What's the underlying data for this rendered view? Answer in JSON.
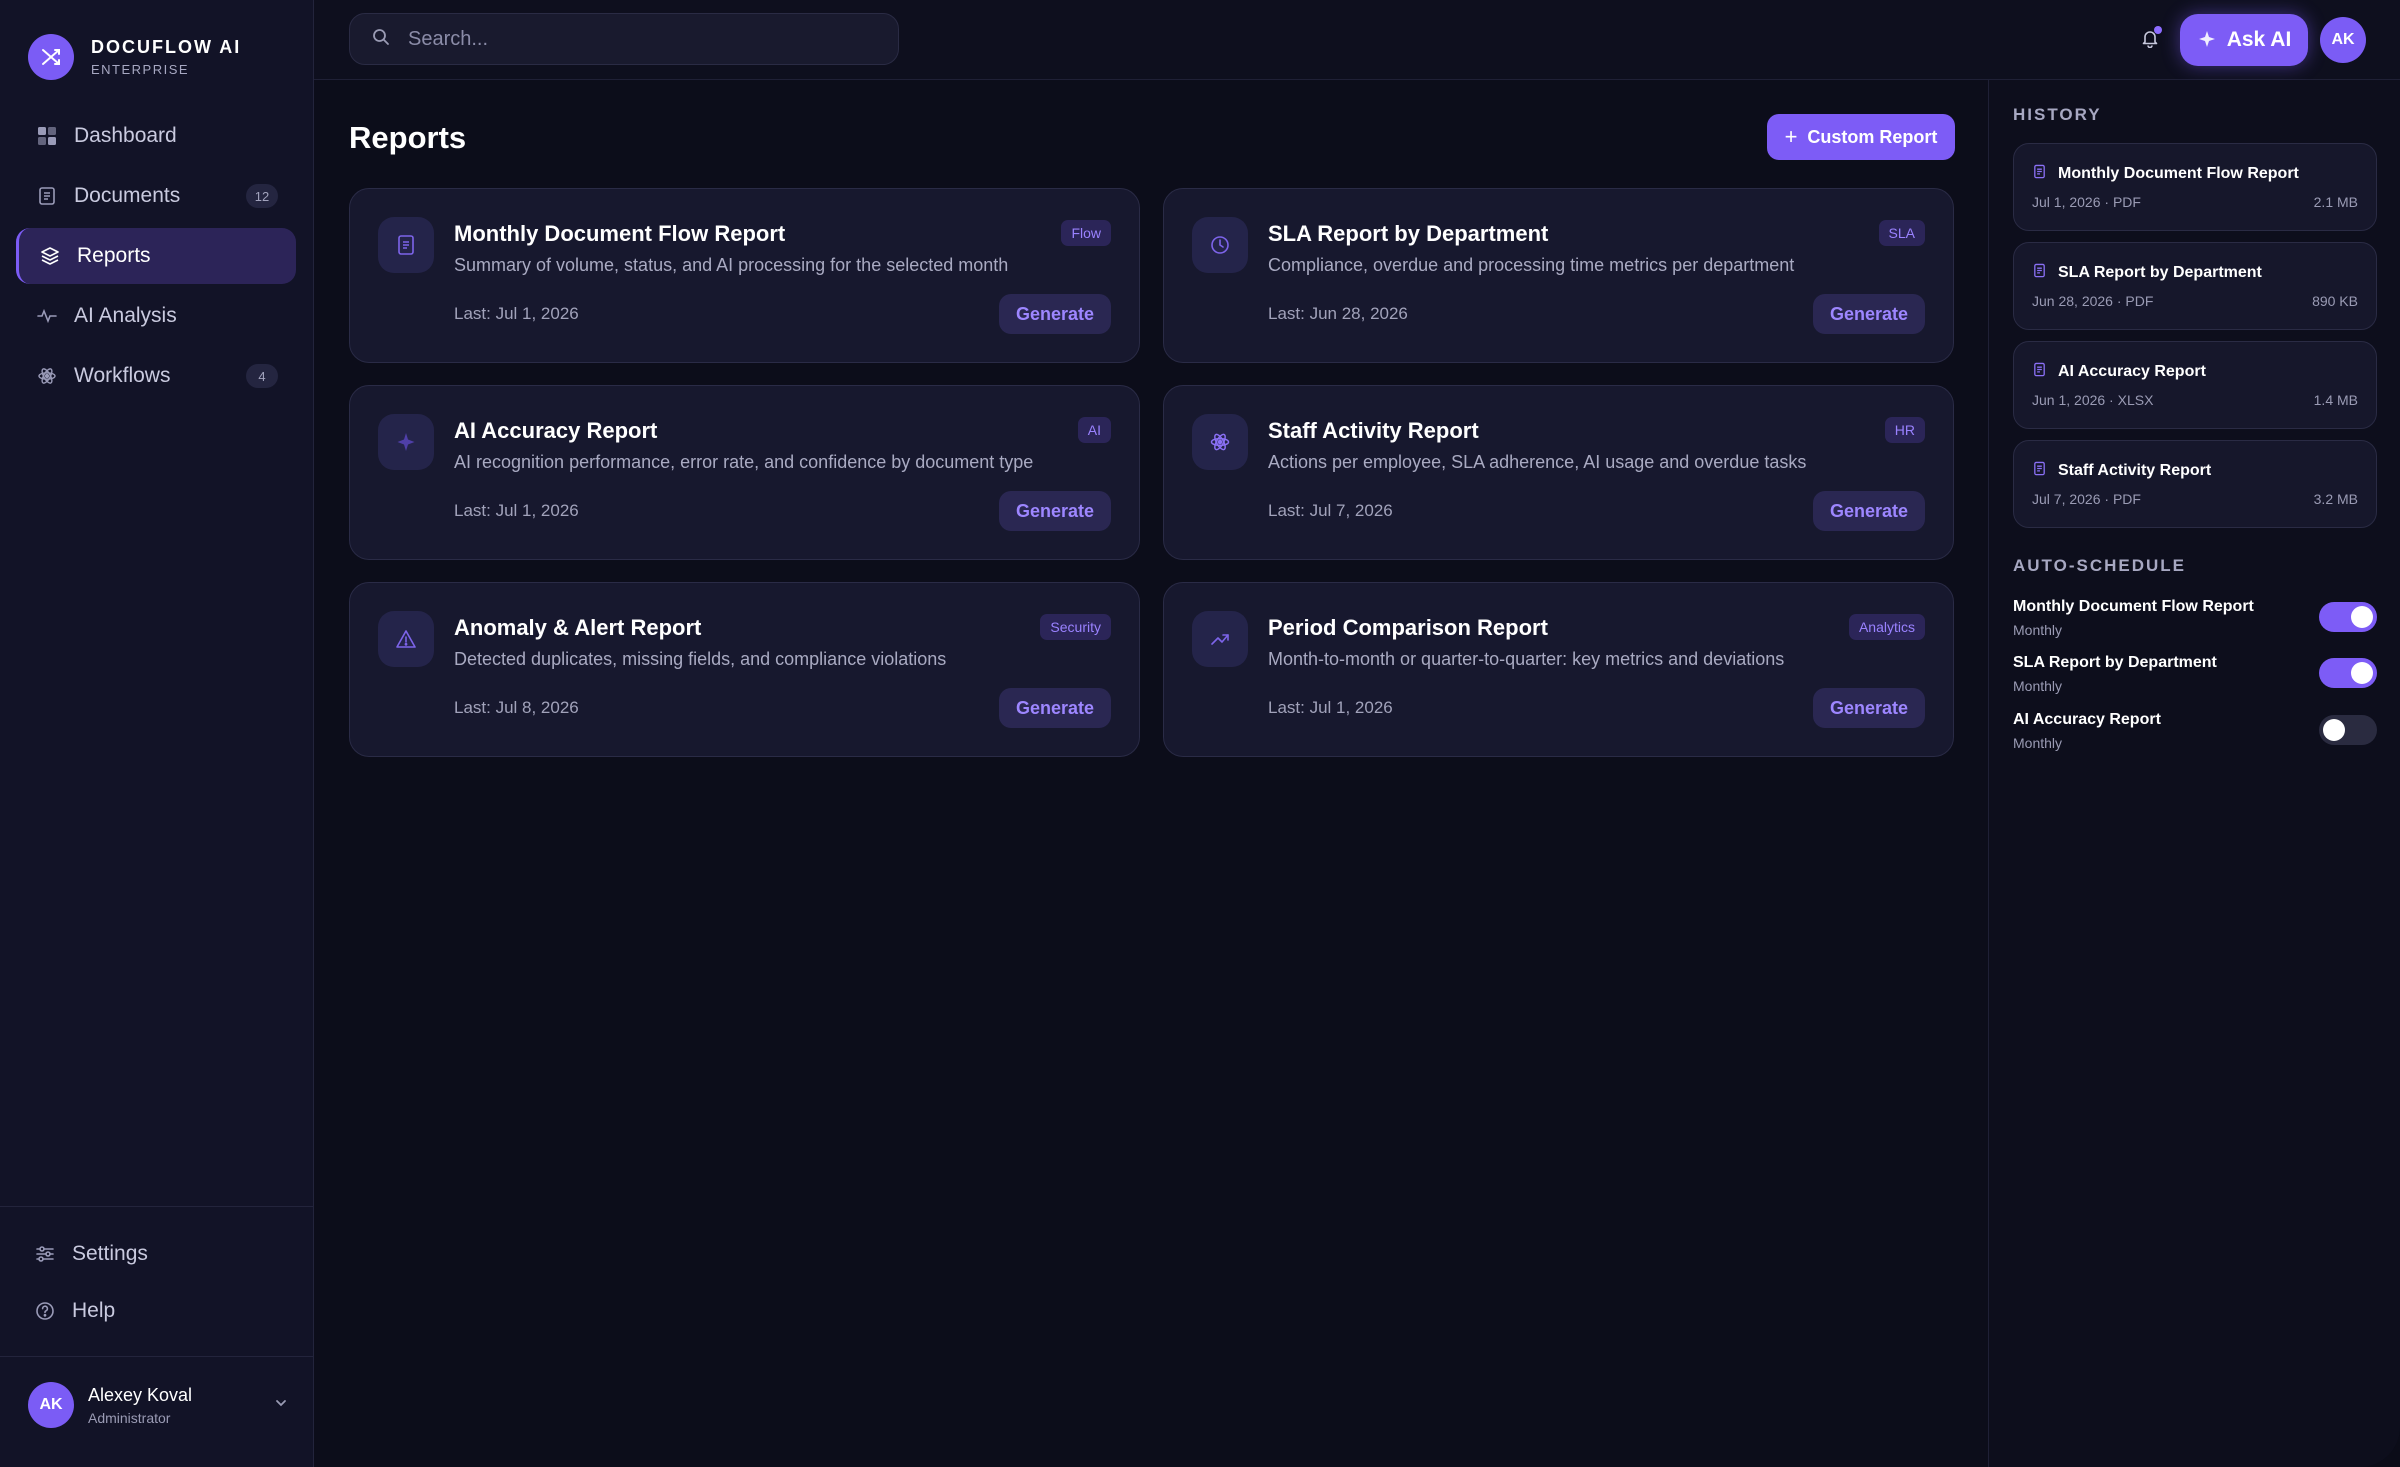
{
  "brand": {
    "name": "DOCUFLOW AI",
    "subtitle": "ENTERPRISE",
    "logo_icon": "shuffle-icon"
  },
  "sidebar": {
    "items": [
      {
        "label": "Dashboard",
        "icon": "grid-icon",
        "badge": ""
      },
      {
        "label": "Documents",
        "icon": "document-icon",
        "badge": "12"
      },
      {
        "label": "Reports",
        "icon": "layers-icon",
        "badge": "",
        "active": true
      },
      {
        "label": "AI Analysis",
        "icon": "pulse-icon",
        "badge": ""
      },
      {
        "label": "Workflows",
        "icon": "atom-icon",
        "badge": "4"
      }
    ],
    "bottom_items": [
      {
        "label": "Settings",
        "icon": "sliders-icon"
      },
      {
        "label": "Help",
        "icon": "help-circle-icon"
      }
    ],
    "user": {
      "initials": "AK",
      "name": "Alexey Koval",
      "role": "Administrator"
    }
  },
  "topbar": {
    "search_placeholder": "Search...",
    "ask_ai_label": "Ask AI",
    "avatar_initials": "AK"
  },
  "main": {
    "title": "Reports",
    "custom_report_label": "Custom Report",
    "generate_label": "Generate",
    "cards": [
      {
        "title": "Monthly Document Flow Report",
        "desc": "Summary of volume, status, and AI processing for the selected month",
        "tag": "Flow",
        "last": "Last: Jul 1, 2026",
        "icon": "document-icon"
      },
      {
        "title": "SLA Report by Department",
        "desc": "Compliance, overdue and processing time metrics per department",
        "tag": "SLA",
        "last": "Last: Jun 28, 2026",
        "icon": "clock-icon"
      },
      {
        "title": "AI Accuracy Report",
        "desc": "AI recognition performance, error rate, and confidence by document type",
        "tag": "AI",
        "last": "Last: Jul 1, 2026",
        "icon": "sparkle-icon"
      },
      {
        "title": "Staff Activity Report",
        "desc": "Actions per employee, SLA adherence, AI usage and overdue tasks",
        "tag": "HR",
        "last": "Last: Jul 7, 2026",
        "icon": "atom-icon"
      },
      {
        "title": "Anomaly & Alert Report",
        "desc": "Detected duplicates, missing fields, and compliance violations",
        "tag": "Security",
        "last": "Last: Jul 8, 2026",
        "icon": "warning-icon"
      },
      {
        "title": "Period Comparison Report",
        "desc": "Month-to-month or quarter-to-quarter: key metrics and deviations",
        "tag": "Analytics",
        "last": "Last: Jul 1, 2026",
        "icon": "trend-up-icon"
      }
    ]
  },
  "right_panel": {
    "history_title": "HISTORY",
    "history": [
      {
        "title": "Monthly Document Flow Report",
        "meta": "Jul 1, 2026 · PDF",
        "size": "2.1 MB"
      },
      {
        "title": "SLA Report by Department",
        "meta": "Jun 28, 2026 · PDF",
        "size": "890 KB"
      },
      {
        "title": "AI Accuracy Report",
        "meta": "Jun 1, 2026 · XLSX",
        "size": "1.4 MB"
      },
      {
        "title": "Staff Activity Report",
        "meta": "Jul 7, 2026 · PDF",
        "size": "3.2 MB"
      }
    ],
    "schedule_title": "AUTO-SCHEDULE",
    "schedule": [
      {
        "name": "Monthly Document Flow Report",
        "freq": "Monthly",
        "enabled": true
      },
      {
        "name": "SLA Report by Department",
        "freq": "Monthly",
        "enabled": true
      },
      {
        "name": "AI Accuracy Report",
        "freq": "Monthly",
        "enabled": false
      }
    ]
  },
  "colors": {
    "accent": "#7d5cf6",
    "background": "#0c0d1a",
    "card": "#17182e",
    "sidebar": "#121327"
  }
}
